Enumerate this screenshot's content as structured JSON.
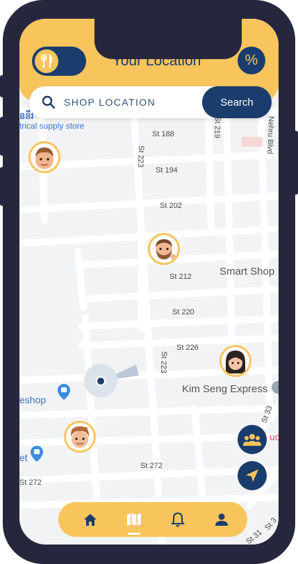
{
  "header": {
    "title": "Your Location",
    "toggle_icon": "fork-knife-icon",
    "discount_label": "%"
  },
  "search": {
    "placeholder": "SHOP LOCATION",
    "button_label": "Search"
  },
  "map": {
    "street_labels": [
      "St 188",
      "St 194",
      "St 202",
      "St 212",
      "St 220",
      "St 226",
      "St 223",
      "St 223",
      "St 272",
      "St 272",
      "St 219",
      "Nehru Blvd"
    ],
    "place_labels": [
      "Smart Shop",
      "Kim Seng Express",
      "trical supply store",
      "eshop"
    ],
    "partial_labels": [
      "ននឹរ",
      "et",
      "St 33",
      "St 31",
      "uc",
      "St 3"
    ]
  },
  "avatars": [
    "avatar-boy-icon",
    "avatar-bearded-man-icon",
    "avatar-girl-icon",
    "avatar-curly-boy-icon"
  ],
  "fabs": {
    "group_icon": "group-icon",
    "navigate_icon": "navigate-arrow-icon"
  },
  "nav": [
    "home-icon",
    "map-icon",
    "bell-icon",
    "user-icon"
  ],
  "colors": {
    "primary": "#1b3d6d",
    "accent": "#f8c45c",
    "frame": "#26273d",
    "map_bg": "#f2f3f5"
  }
}
